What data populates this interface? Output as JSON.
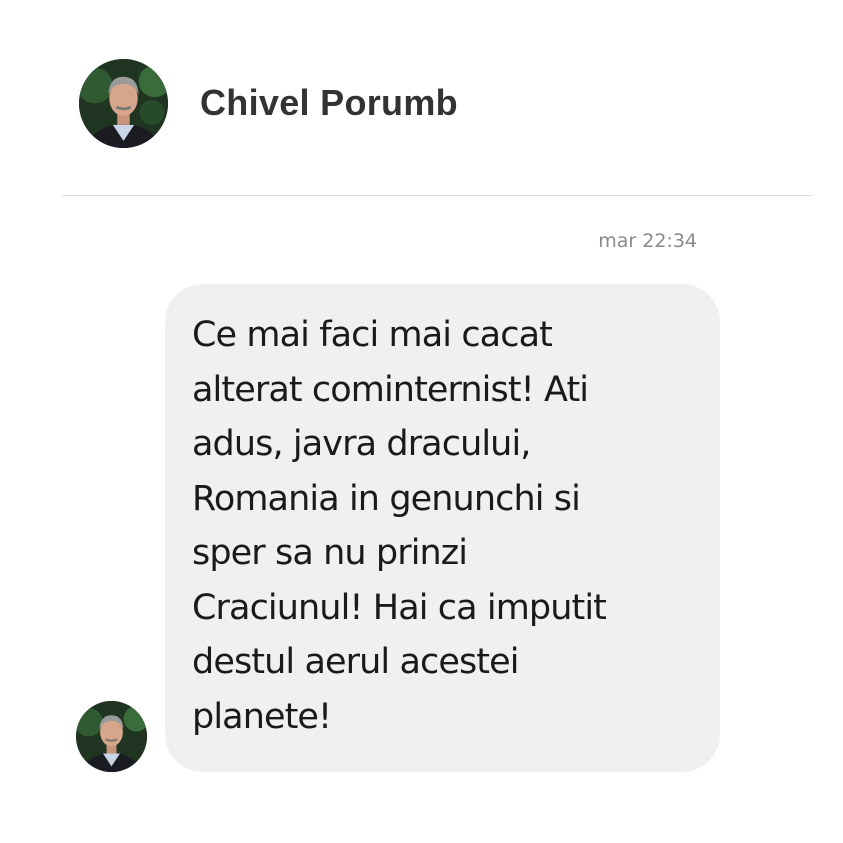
{
  "conversation": {
    "contact_name": "Chivel Porumb",
    "avatar_icon": "profile-photo-avatar"
  },
  "message": {
    "timestamp": "mar 22:34",
    "text": "Ce mai faci mai cacat\nalterat cominternist! Ati\nadus, javra dracului,\nRomania in genunchi si\nsper sa nu prinzi\nCraciunul! Hai ca imputit\ndestul aerul acestei\nplanete!",
    "bubble_color": "#f1f0f0",
    "text_color": "#1a1a1a"
  }
}
